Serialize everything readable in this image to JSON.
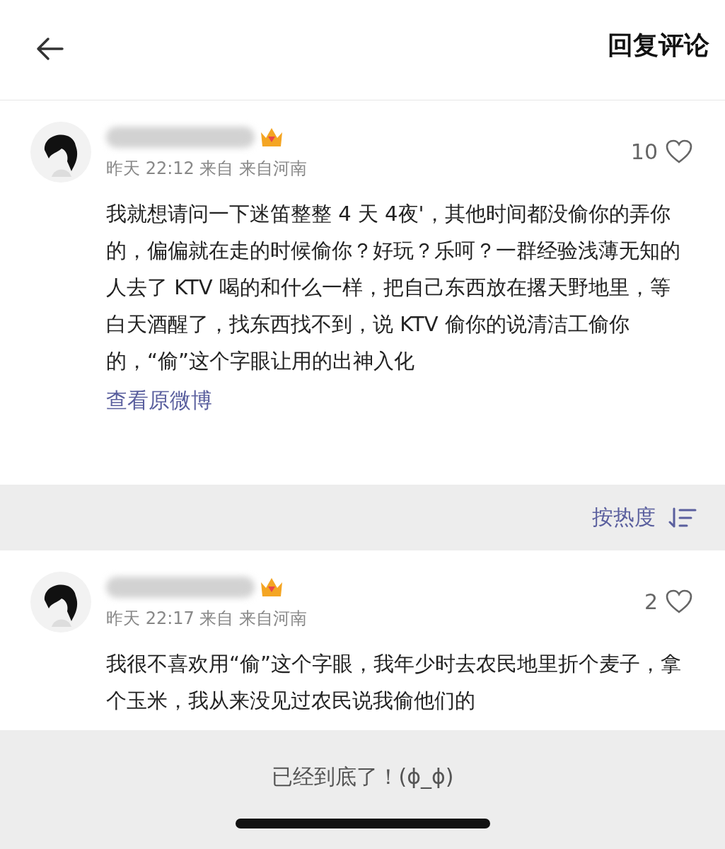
{
  "header": {
    "title": "回复评论"
  },
  "main_comment": {
    "meta": "昨天 22:12 来自 来自河南",
    "likes": "10",
    "text": "我就想请问一下迷笛整整 4 天 4夜'，其他时间都没偷你的弄你的，偏偏就在走的时候偷你？好玩？乐呵？一群经验浅薄无知的人去了 KTV 喝的和什么一样，把自己东西放在撂天野地里，等白天酒醒了，找东西找不到，说 KTV 偷你的说清洁工偷你的，“偷”这个字眼让用的出神入化",
    "link": "查看原微博"
  },
  "sort": {
    "label": "按热度"
  },
  "replies": [
    {
      "meta": "昨天 22:17 来自 来自河南",
      "likes": "2",
      "text": "我很不喜欢用“偷”这个字眼，我年少时去农民地里折个麦子，拿个玉米，我从来没见过农民说我偷他们的"
    }
  ],
  "footer": {
    "text": "已经到底了！(ɸ_ɸ)"
  }
}
